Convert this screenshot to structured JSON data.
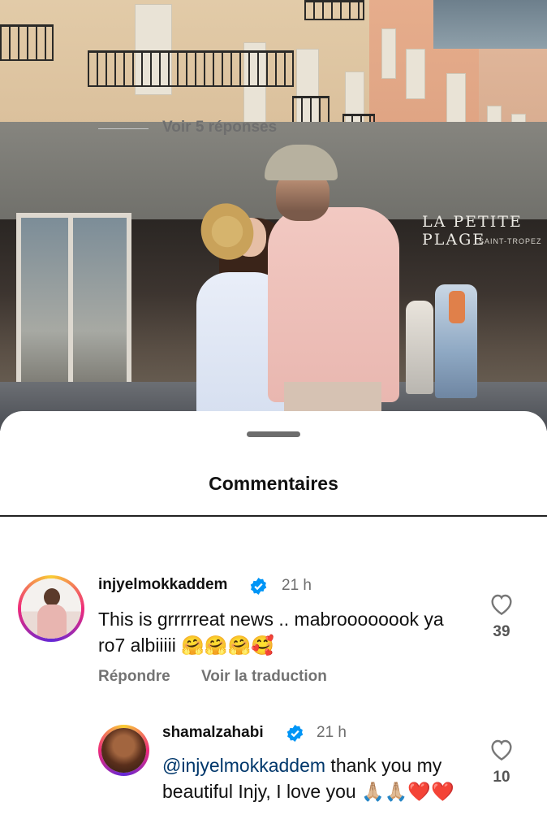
{
  "photo": {
    "storefront_sign": "LA PETITE PLAGE",
    "storefront_subsign": "SAINT-TROPEZ"
  },
  "sheet": {
    "title": "Commentaires",
    "view_replies": "Voir 5 réponses"
  },
  "comments": [
    {
      "username": "injyelmokkaddem",
      "verified": true,
      "time": "21 h",
      "text": "This is grrrrreat news .. mabroooooook ya ro7 albiiiii 🤗🤗🤗🥰",
      "reply_label": "Répondre",
      "translate_label": "Voir la traduction",
      "likes": "39"
    },
    {
      "username": "shamalzahabi",
      "verified": true,
      "time": "21 h",
      "mention": "@injyelmokkaddem",
      "text": " thank you my beautiful Injy, I love you 🙏🏼🙏🏼❤️❤️",
      "likes": "10"
    }
  ],
  "colors": {
    "verified_blue": "#0095f6",
    "mention": "#00376b",
    "secondary_text": "#737373"
  },
  "icons": [
    "verified-badge-icon",
    "heart-outline-icon"
  ]
}
